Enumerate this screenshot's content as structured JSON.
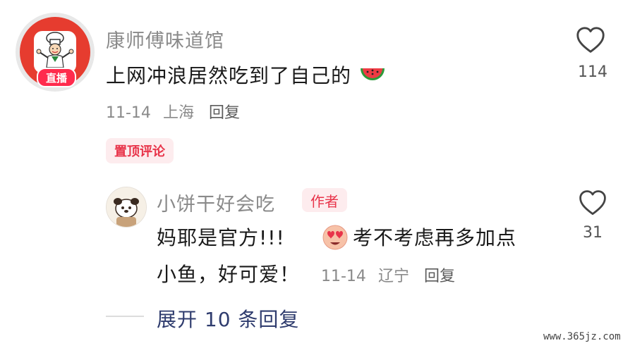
{
  "comment": {
    "author": "康师傅味道馆",
    "live_badge": "直播",
    "text": "上网冲浪居然吃到了自己的",
    "text_emoji": "watermelon-emoji",
    "date": "11-14",
    "location": "上海",
    "reply_label": "回复",
    "pin_label": "置顶评论",
    "likes": "114"
  },
  "reply": {
    "author": "小饼干好会吃",
    "author_badge": "作者",
    "text_line1_start": "妈耶是官方!!!",
    "text_line1_emoji": "smiling-face-with-heart-eyes-emoji",
    "text_line1_end": "考不考虑再多加点",
    "text_line2": "小鱼，好可爱！",
    "date": "11-14",
    "location": "辽宁",
    "reply_label": "回复",
    "likes": "31"
  },
  "expand": {
    "label": "展开 10 条回复"
  },
  "watermark": "www.365jz.com",
  "colors": {
    "accent_red": "#e8344a",
    "pin_bg": "#fdecee",
    "expand_blue": "#2f3c6e"
  }
}
